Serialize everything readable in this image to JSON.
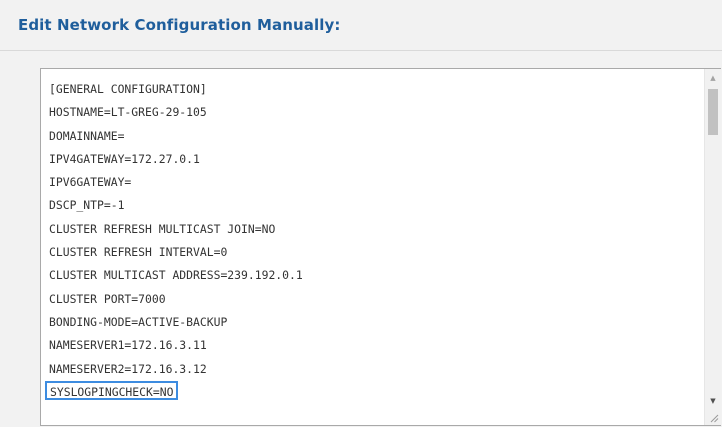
{
  "header": {
    "title": "Edit Network Configuration Manually:"
  },
  "config": {
    "lines": [
      "[GENERAL CONFIGURATION]",
      "HOSTNAME=LT-GREG-29-105",
      "DOMAINNAME=",
      "IPV4GATEWAY=172.27.0.1",
      "IPV6GATEWAY=",
      "DSCP_NTP=-1",
      "CLUSTER REFRESH MULTICAST JOIN=NO",
      "CLUSTER REFRESH INTERVAL=0",
      "CLUSTER MULTICAST ADDRESS=239.192.0.1",
      "CLUSTER PORT=7000",
      "BONDING-MODE=ACTIVE-BACKUP",
      "NAMESERVER1=172.16.3.11",
      "NAMESERVER2=172.16.3.12",
      "SYSLOGPINGCHECK=NO"
    ]
  },
  "scrollbar": {
    "up_icon": "scroll-up-arrow",
    "down_icon": "scroll-down-arrow"
  },
  "colors": {
    "title": "#1f5e9c",
    "highlight_border": "#3d8ce0",
    "panel_background": "#f2f2f2"
  }
}
